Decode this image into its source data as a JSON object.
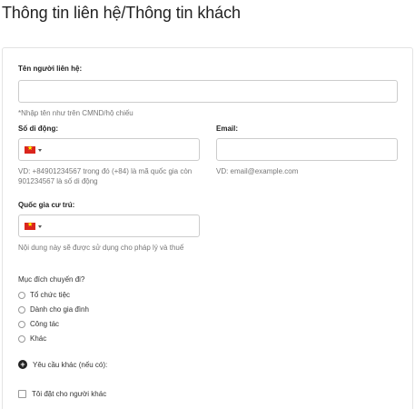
{
  "title": "Thông tin liên hệ/Thông tin khách",
  "contact_name": {
    "label": "Tên người liên hệ:",
    "value": "",
    "hint": "*Nhập tên như trên CMND/hộ chiếu"
  },
  "phone": {
    "label": "Số di động:",
    "country_icon": "vietnam-flag-icon",
    "value": "",
    "hint_line1": "VD: +84901234567 trong đó (+84) là mã quốc gia còn",
    "hint_line2": "901234567 là số di động"
  },
  "email": {
    "label": "Email:",
    "value": "",
    "hint": "VD: email@example.com"
  },
  "residence": {
    "label": "Quốc gia cư trú:",
    "country_icon": "vietnam-flag-icon",
    "hint": "Nội dung này sẽ được sử dụng cho pháp lý và thuế"
  },
  "trip_purpose": {
    "question": "Mục đích chuyến đi?",
    "options": [
      "Tổ chức tiệc",
      "Dành cho gia đình",
      "Công tác",
      "Khác"
    ]
  },
  "other_request": {
    "label": "Yêu cầu khác (nếu có):"
  },
  "book_for_others": {
    "label": "Tôi đặt cho người khác",
    "checked": false
  },
  "colors": {
    "border": "#cccccc",
    "hint_text": "#777777",
    "flag_red": "#da251d",
    "flag_star": "#ffff00"
  }
}
